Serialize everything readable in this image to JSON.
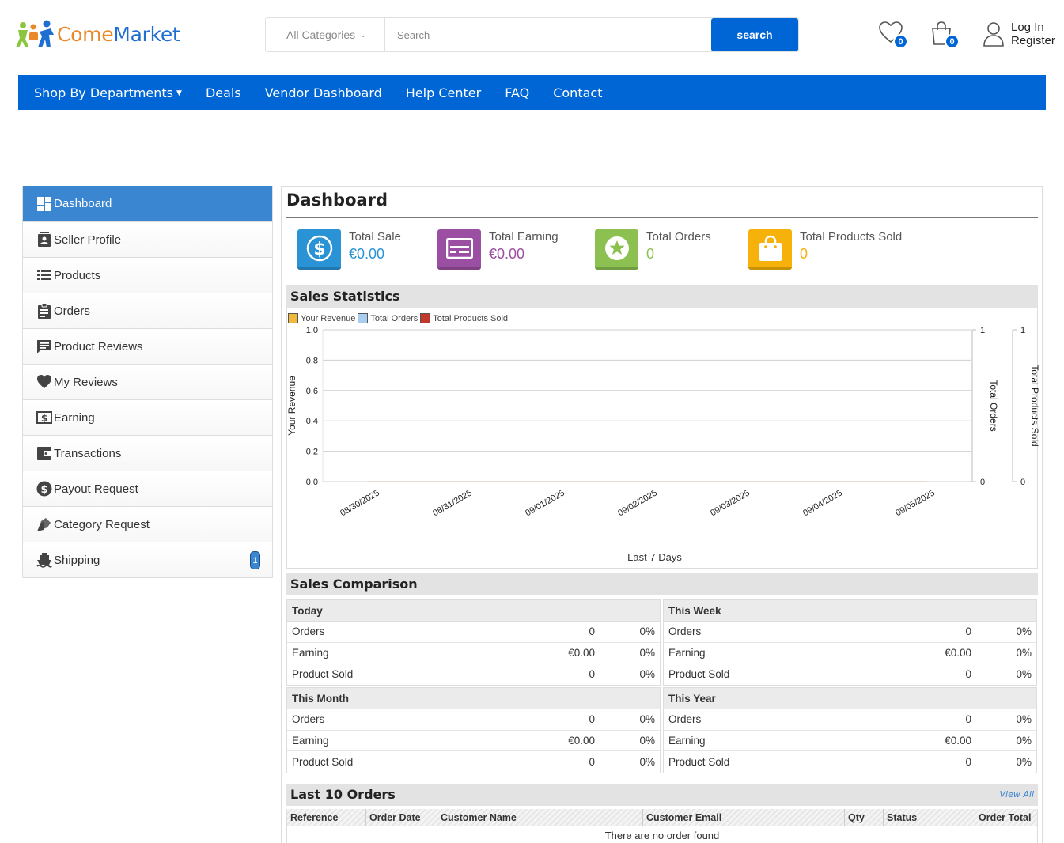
{
  "header": {
    "logo_part1": "Come",
    "logo_part2": "Market",
    "category_select": "All Categories",
    "search_placeholder": "Search",
    "search_button": "search",
    "wishlist_count": "0",
    "cart_count": "0",
    "login_label": "Log In",
    "register_label": "Register"
  },
  "nav": {
    "items": [
      "Shop By Departments",
      "Deals",
      "Vendor Dashboard",
      "Help Center",
      "FAQ",
      "Contact"
    ]
  },
  "sidebar": {
    "items": [
      {
        "label": "Dashboard",
        "icon": "dashboard-icon"
      },
      {
        "label": "Seller Profile",
        "icon": "profile-card-icon"
      },
      {
        "label": "Products",
        "icon": "list-icon"
      },
      {
        "label": "Orders",
        "icon": "clipboard-icon"
      },
      {
        "label": "Product Reviews",
        "icon": "comment-icon"
      },
      {
        "label": "My Reviews",
        "icon": "heart-icon"
      },
      {
        "label": "Earning",
        "icon": "dollar-bill-icon"
      },
      {
        "label": "Transactions",
        "icon": "wallet-icon"
      },
      {
        "label": "Payout Request",
        "icon": "dollar-coin-icon"
      },
      {
        "label": "Category Request",
        "icon": "tag-icon"
      },
      {
        "label": "Shipping",
        "icon": "ship-icon",
        "badge": "1"
      }
    ]
  },
  "dashboard": {
    "title": "Dashboard",
    "stats": [
      {
        "label": "Total Sale",
        "value": "€0.00",
        "color": "#2a93d5"
      },
      {
        "label": "Total Earning",
        "value": "€0.00",
        "color": "#9b4fa2"
      },
      {
        "label": "Total Orders",
        "value": "0",
        "color": "#8cc152"
      },
      {
        "label": "Total Products Sold",
        "value": "0",
        "color": "#f6b10a"
      }
    ],
    "sales_statistics_title": "Sales Statistics",
    "sales_comparison_title": "Sales Comparison",
    "comparison": [
      {
        "period": "Today",
        "rows": [
          {
            "label": "Orders",
            "value": "0",
            "pct": "0%"
          },
          {
            "label": "Earning",
            "value": "€0.00",
            "pct": "0%"
          },
          {
            "label": "Product Sold",
            "value": "0",
            "pct": "0%"
          }
        ]
      },
      {
        "period": "This Week",
        "rows": [
          {
            "label": "Orders",
            "value": "0",
            "pct": "0%"
          },
          {
            "label": "Earning",
            "value": "€0.00",
            "pct": "0%"
          },
          {
            "label": "Product Sold",
            "value": "0",
            "pct": "0%"
          }
        ]
      },
      {
        "period": "This Month",
        "rows": [
          {
            "label": "Orders",
            "value": "0",
            "pct": "0%"
          },
          {
            "label": "Earning",
            "value": "€0.00",
            "pct": "0%"
          },
          {
            "label": "Product Sold",
            "value": "0",
            "pct": "0%"
          }
        ]
      },
      {
        "period": "This Year",
        "rows": [
          {
            "label": "Orders",
            "value": "0",
            "pct": "0%"
          },
          {
            "label": "Earning",
            "value": "€0.00",
            "pct": "0%"
          },
          {
            "label": "Product Sold",
            "value": "0",
            "pct": "0%"
          }
        ]
      }
    ],
    "orders_title": "Last 10 Orders",
    "view_all": "View All",
    "orders_columns": [
      "Reference",
      "Order Date",
      "Customer Name",
      "Customer Email",
      "Qty",
      "Status",
      "Order Total"
    ],
    "orders_empty": "There are no order found"
  },
  "chart_data": {
    "type": "line",
    "categories": [
      "08/30/2025",
      "08/31/2025",
      "09/01/2025",
      "09/02/2025",
      "09/03/2025",
      "09/04/2025",
      "09/05/2025"
    ],
    "series": [
      {
        "name": "Your Revenue",
        "values": [
          0,
          0,
          0,
          0,
          0,
          0,
          0
        ],
        "color": "#f0b93b"
      },
      {
        "name": "Total Orders",
        "values": [
          0,
          0,
          0,
          0,
          0,
          0,
          0
        ],
        "color": "#a8cdee"
      },
      {
        "name": "Total Products Sold",
        "values": [
          0,
          0,
          0,
          0,
          0,
          0,
          0
        ],
        "color": "#c0392b"
      }
    ],
    "xlabel": "Last 7 Days",
    "ylabel": "Your Revenue",
    "ylabel_right1": "Total Orders",
    "ylabel_right2": "Total Products Sold",
    "ylim": [
      0,
      1
    ],
    "yticks": [
      "0.0",
      "0.2",
      "0.4",
      "0.6",
      "0.8",
      "1.0"
    ],
    "y2ticks": [
      "0",
      "1"
    ],
    "y3ticks": [
      "0",
      "1"
    ],
    "grid": true,
    "legend": "top-left"
  }
}
